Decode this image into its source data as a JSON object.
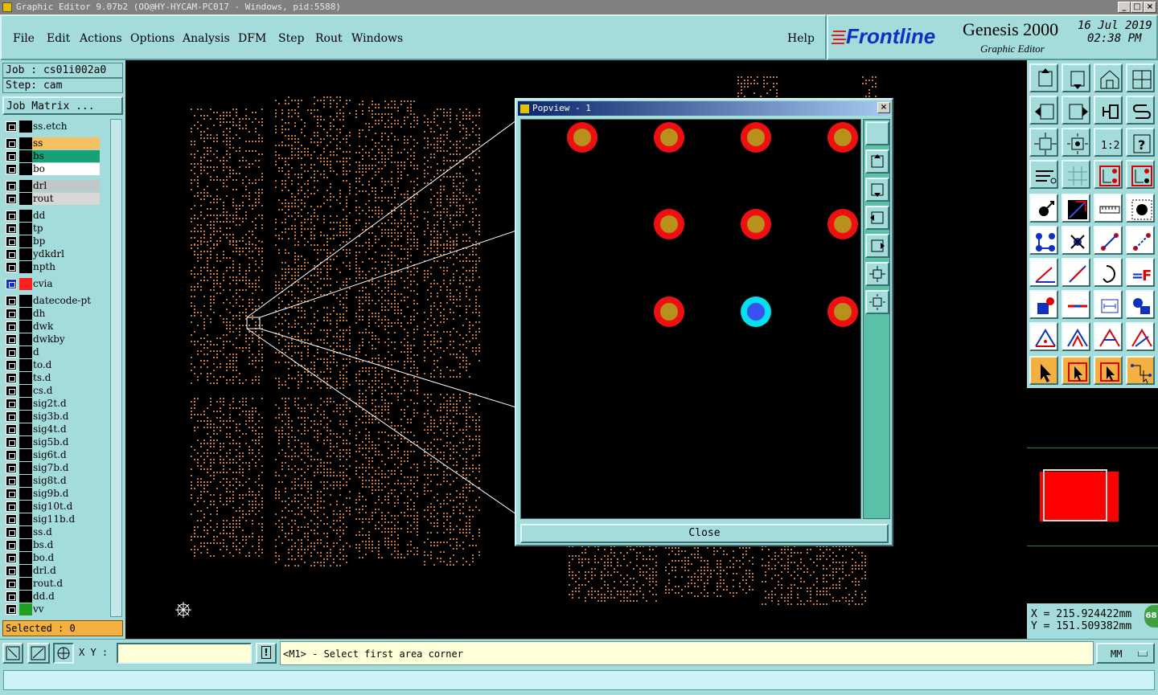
{
  "window": {
    "title": "Graphic Editor 9.07b2 (OO@HY-HYCAM-PC017 - Windows, pid:5588)"
  },
  "menu": {
    "items": [
      "File",
      "Edit",
      "Actions",
      "Options",
      "Analysis",
      "DFM",
      "Step",
      "Rout",
      "Windows"
    ],
    "help": "Help"
  },
  "brand": {
    "logo": "Frontline",
    "product": "Genesis 2000",
    "subtitle": "Graphic Editor",
    "date": "16 Jul 2019",
    "time": "02:38 PM"
  },
  "job": {
    "job_line": "Job : cs01i002a0",
    "step_line": "Step: cam",
    "matrix_button": "Job Matrix ..."
  },
  "layers": [
    {
      "name": "ss.etch",
      "color": "#a4dcdc"
    },
    {
      "name": "ss",
      "color": "#f4c060"
    },
    {
      "name": "bs",
      "color": "#18a078"
    },
    {
      "name": "bo",
      "color": "#ffffff"
    },
    {
      "name": "drl",
      "color": "#c0c8c8"
    },
    {
      "name": "rout",
      "color": "#d8d8d8"
    },
    {
      "name": "dd",
      "color": "#a4dcdc"
    },
    {
      "name": "tp",
      "color": "#a4dcdc"
    },
    {
      "name": "bp",
      "color": "#a4dcdc"
    },
    {
      "name": "ydkdrl",
      "color": "#a4dcdc"
    },
    {
      "name": "npth",
      "color": "#a4dcdc"
    },
    {
      "name": "cvia",
      "color": "#a4dcdc"
    },
    {
      "name": "datecode-pt",
      "color": "#a4dcdc"
    },
    {
      "name": "dh",
      "color": "#a4dcdc"
    },
    {
      "name": "dwk",
      "color": "#a4dcdc"
    },
    {
      "name": "dwkby",
      "color": "#a4dcdc"
    },
    {
      "name": "d",
      "color": "#a4dcdc"
    },
    {
      "name": "to.d",
      "color": "#a4dcdc"
    },
    {
      "name": "ts.d",
      "color": "#a4dcdc"
    },
    {
      "name": "cs.d",
      "color": "#a4dcdc"
    },
    {
      "name": "sig2t.d",
      "color": "#a4dcdc"
    },
    {
      "name": "sig3b.d",
      "color": "#a4dcdc"
    },
    {
      "name": "sig4t.d",
      "color": "#a4dcdc"
    },
    {
      "name": "sig5b.d",
      "color": "#a4dcdc"
    },
    {
      "name": "sig6t.d",
      "color": "#a4dcdc"
    },
    {
      "name": "sig7b.d",
      "color": "#a4dcdc"
    },
    {
      "name": "sig8t.d",
      "color": "#a4dcdc"
    },
    {
      "name": "sig9b.d",
      "color": "#a4dcdc"
    },
    {
      "name": "sig10t.d",
      "color": "#a4dcdc"
    },
    {
      "name": "sig11b.d",
      "color": "#a4dcdc"
    },
    {
      "name": "ss.d",
      "color": "#a4dcdc"
    },
    {
      "name": "bs.d",
      "color": "#a4dcdc"
    },
    {
      "name": "bo.d",
      "color": "#a4dcdc"
    },
    {
      "name": "drl.d",
      "color": "#a4dcdc"
    },
    {
      "name": "rout.d",
      "color": "#a4dcdc"
    },
    {
      "name": "dd.d",
      "color": "#a4dcdc"
    },
    {
      "name": "vv",
      "color": "#a4dcdc"
    }
  ],
  "selected": "Selected : 0",
  "popview": {
    "title": "Popview - 1",
    "close_label": "Close"
  },
  "coords": {
    "x": "X = 215.924422mm",
    "y": "Y = 151.509382mm",
    "badge": "68"
  },
  "command": {
    "xy_label": "X Y :",
    "xy_value": "",
    "prompt": "<M1> - Select first area corner",
    "units": "MM"
  },
  "colors": {
    "panel": "#a4dcdc",
    "pad_outer": "#ee1010",
    "pad_inner": "#b8901c",
    "via_outer": "#00e0f0",
    "via_inner": "#3a50f0",
    "feature_dots": "#c87830"
  }
}
